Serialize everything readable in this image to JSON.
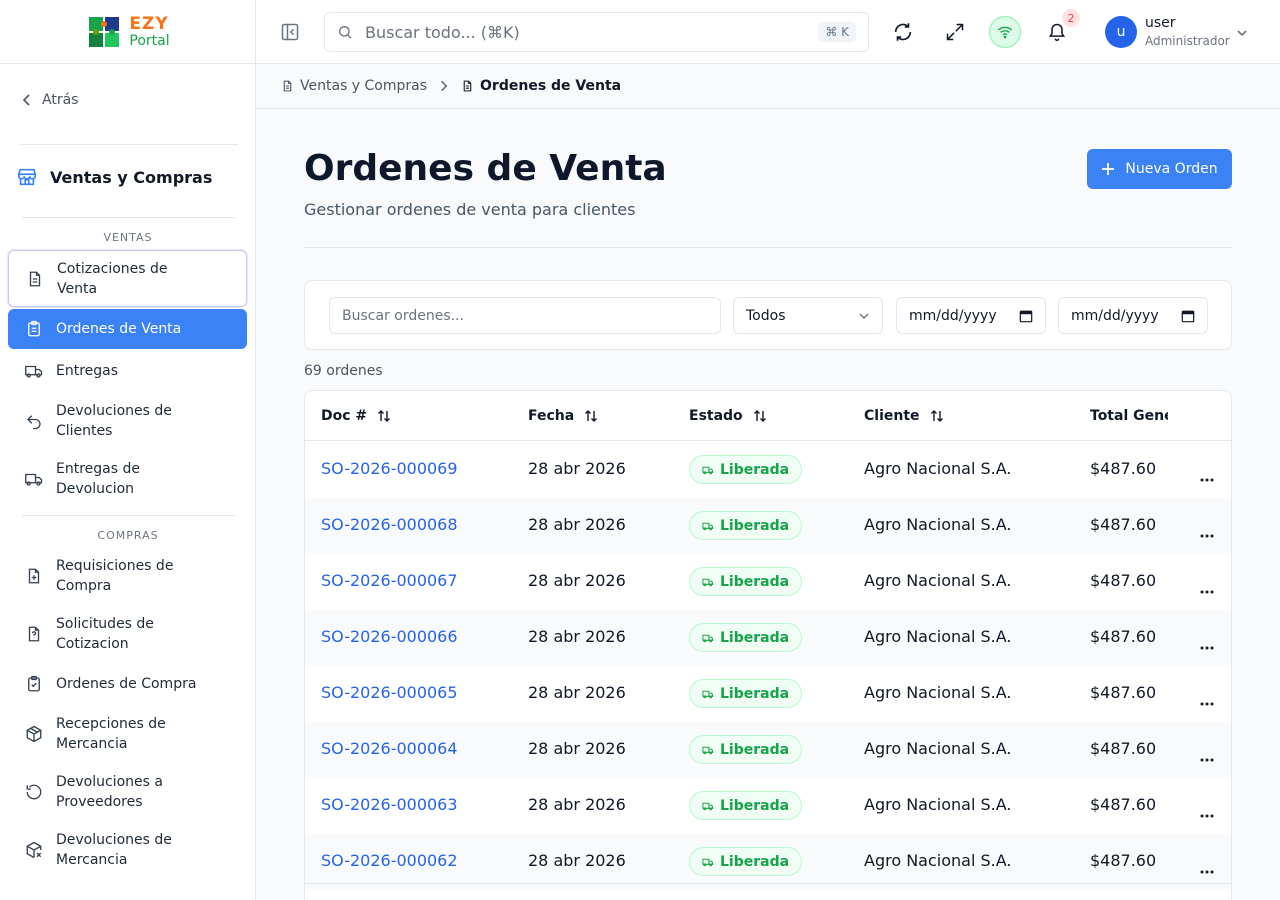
{
  "brand": {
    "top": "EZY",
    "bottom": "Portal"
  },
  "sidebar": {
    "back_label": "Atrás",
    "module_title": "Ventas y Compras",
    "groups": [
      {
        "label": "VENTAS",
        "items": [
          {
            "label": "Cotizaciones de Venta",
            "icon": "document-icon"
          },
          {
            "label": "Ordenes de Venta",
            "icon": "clipboard-list-icon"
          },
          {
            "label": "Entregas",
            "icon": "truck-icon"
          },
          {
            "label": "Devoluciones de Clientes",
            "icon": "undo-arrow-icon"
          },
          {
            "label": "Entregas de Devolucion",
            "icon": "truck-icon"
          }
        ]
      },
      {
        "label": "COMPRAS",
        "items": [
          {
            "label": "Requisiciones de Compra",
            "icon": "file-plus-icon"
          },
          {
            "label": "Solicitudes de Cotizacion",
            "icon": "file-question-icon"
          },
          {
            "label": "Ordenes de Compra",
            "icon": "clipboard-check-icon"
          },
          {
            "label": "Recepciones de Mercancia",
            "icon": "package-icon"
          },
          {
            "label": "Devoluciones a Proveedores",
            "icon": "rotate-ccw-icon"
          },
          {
            "label": "Devoluciones de Mercancia",
            "icon": "package-x-icon"
          }
        ]
      }
    ]
  },
  "header": {
    "search_placeholder": "Buscar todo... (⌘K)",
    "search_shortcut": "⌘ K",
    "notification_count": "2",
    "user": {
      "initial": "u",
      "name": "user",
      "role": "Administrador"
    }
  },
  "breadcrumb": [
    "Ventas y Compras",
    "Ordenes de Venta"
  ],
  "page": {
    "title": "Ordenes de Venta",
    "subtitle": "Gestionar ordenes de venta para clientes",
    "new_button": "Nueva Orden"
  },
  "filters": {
    "search_placeholder": "Buscar ordenes...",
    "status_value": "Todos",
    "date_from": "mm/dd/yyyy",
    "date_to": "mm/dd/yyyy"
  },
  "table": {
    "count_label": "69 ordenes",
    "columns": [
      "Doc #",
      "Fecha",
      "Estado",
      "Cliente",
      "Total General"
    ],
    "rows": [
      {
        "doc": "SO-2026-000069",
        "fecha": "28 abr 2026",
        "estado": "Liberada",
        "cliente": "Agro Nacional S.A.",
        "total": "$487.60"
      },
      {
        "doc": "SO-2026-000068",
        "fecha": "28 abr 2026",
        "estado": "Liberada",
        "cliente": "Agro Nacional S.A.",
        "total": "$487.60"
      },
      {
        "doc": "SO-2026-000067",
        "fecha": "28 abr 2026",
        "estado": "Liberada",
        "cliente": "Agro Nacional S.A.",
        "total": "$487.60"
      },
      {
        "doc": "SO-2026-000066",
        "fecha": "28 abr 2026",
        "estado": "Liberada",
        "cliente": "Agro Nacional S.A.",
        "total": "$487.60"
      },
      {
        "doc": "SO-2026-000065",
        "fecha": "28 abr 2026",
        "estado": "Liberada",
        "cliente": "Agro Nacional S.A.",
        "total": "$487.60"
      },
      {
        "doc": "SO-2026-000064",
        "fecha": "28 abr 2026",
        "estado": "Liberada",
        "cliente": "Agro Nacional S.A.",
        "total": "$487.60"
      },
      {
        "doc": "SO-2026-000063",
        "fecha": "28 abr 2026",
        "estado": "Liberada",
        "cliente": "Agro Nacional S.A.",
        "total": "$487.60"
      },
      {
        "doc": "SO-2026-000062",
        "fecha": "28 abr 2026",
        "estado": "Liberada",
        "cliente": "Agro Nacional S.A.",
        "total": "$487.60"
      }
    ]
  },
  "colors": {
    "accent": "#3b82f6",
    "link": "#2563eb",
    "status_released": "#16a34a",
    "logo_orange": "#f97316",
    "logo_green": "#16a34a"
  }
}
